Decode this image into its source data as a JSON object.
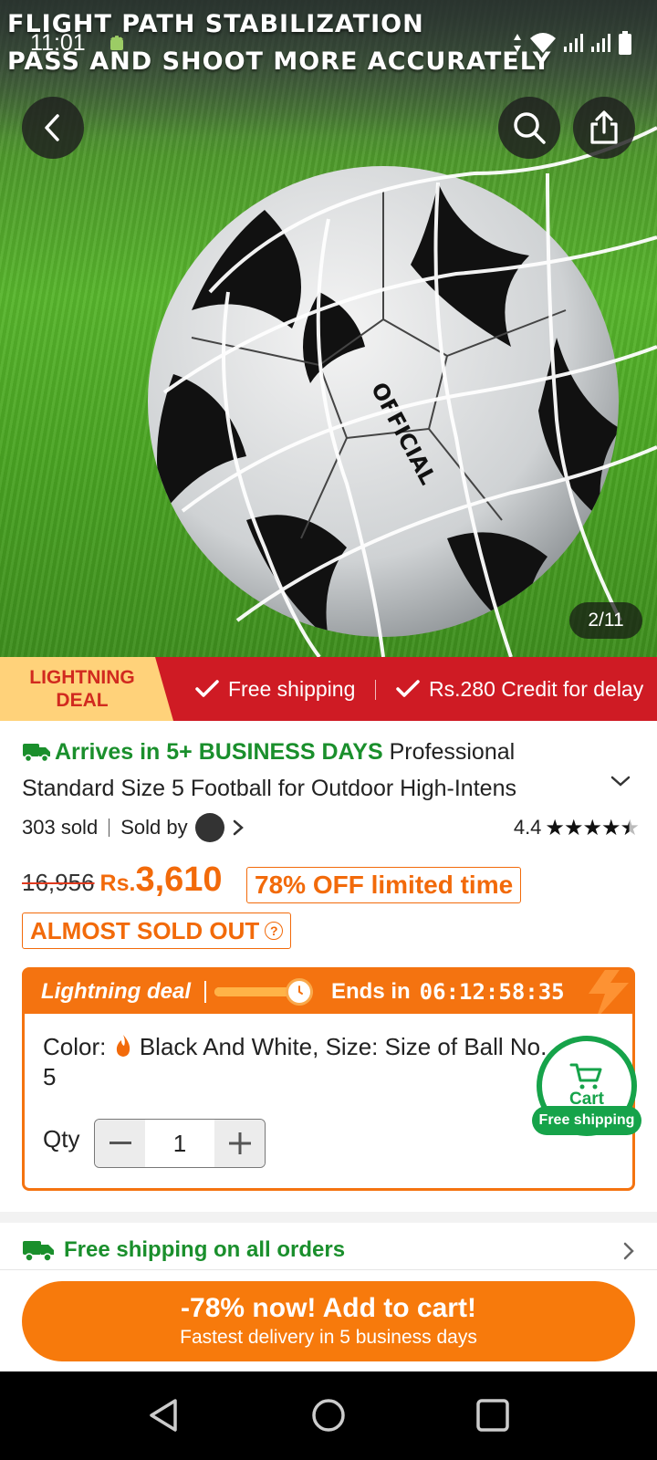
{
  "status_bar": {
    "time": "11:01"
  },
  "hero": {
    "overlay_line1": "FLIGHT PATH STABILIZATION",
    "overlay_line2": "PASS AND SHOOT MORE ACCURATELY",
    "ball_text": "OFFICIAL",
    "image_counter": "2/11"
  },
  "banner": {
    "deal_label_line1": "LIGHTNING",
    "deal_label_line2": "DEAL",
    "free_shipping": "Free shipping",
    "credit": "Rs.280 Credit for delay"
  },
  "product": {
    "arrives": "Arrives in 5+ BUSINESS DAYS",
    "title": "Professional Standard Size 5 Football for Outdoor High-Intens",
    "sold": "303 sold",
    "sold_by": "Sold by",
    "rating": "4.4",
    "rating_stars": 4.4,
    "old_price": "16,956",
    "currency": "Rs.",
    "price": "3,610",
    "discount": "78% OFF limited time",
    "almost_sold_out": "ALMOST SOLD OUT"
  },
  "deal": {
    "label": "Lightning deal",
    "progress_fraction": 0.8,
    "ends_in_label": "Ends in",
    "countdown": "06:12:58:35",
    "color_label": "Color:",
    "color_value": "Black And White, Size: Size of Ball No. 5",
    "qty_label": "Qty",
    "qty_value": "1"
  },
  "cart": {
    "label": "Cart",
    "badge": "Free shipping"
  },
  "shipping": {
    "text": "Free shipping on all orders"
  },
  "cta": {
    "main": "-78% now! Add to cart!",
    "sub": "Fastest delivery in 5 business days"
  },
  "colors": {
    "accent_orange": "#f77a0c",
    "banner_red": "#cf1b24",
    "success_green": "#16a34a"
  }
}
